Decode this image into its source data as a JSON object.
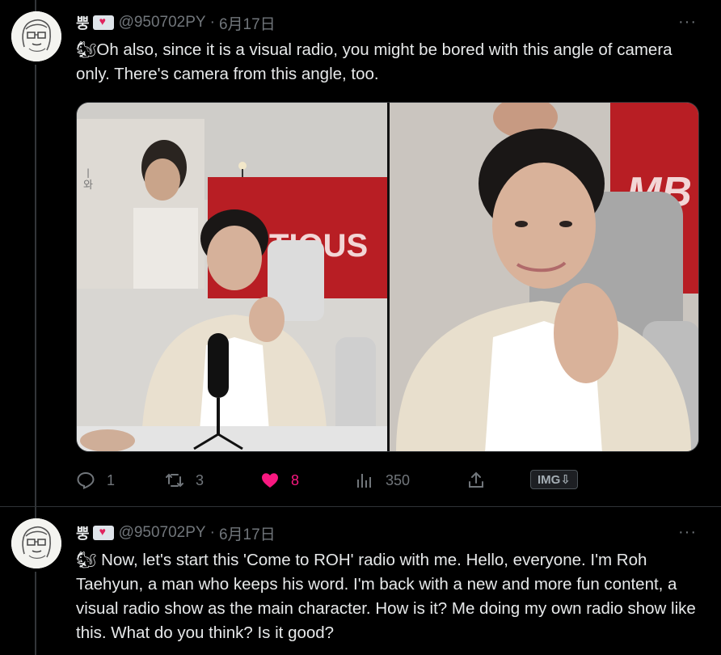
{
  "tweets": [
    {
      "name": "뿡",
      "handle": "@950702PY",
      "separator": "·",
      "date": "6月17日",
      "more": "···",
      "emoji": "🐿",
      "text": "Oh also, since it is a visual radio, you might be bored with this angle of camera only. There's camera from this angle, too.",
      "media": {
        "left_sign": "TIOUS",
        "right_sign": "MB",
        "poster_text": "ㅣ\n와"
      },
      "actions": {
        "replies": "1",
        "retweets": "3",
        "likes": "8",
        "views": "350",
        "img_button": "IMG⇩"
      }
    },
    {
      "name": "뿡",
      "handle": "@950702PY",
      "separator": "·",
      "date": "6月17日",
      "more": "···",
      "emoji": "🐿",
      "text": " Now, let's start this 'Come to ROH' radio with me. Hello, everyone. I'm Roh Taehyun, a man who keeps his word. I'm back with a new and more fun content, a visual radio show as the main character. How is it? Me doing my own radio show like this. What do you think? Is it good?"
    }
  ],
  "colors": {
    "background": "#000000",
    "text": "#e7e9ea",
    "muted": "#71767b",
    "like": "#f91880"
  }
}
